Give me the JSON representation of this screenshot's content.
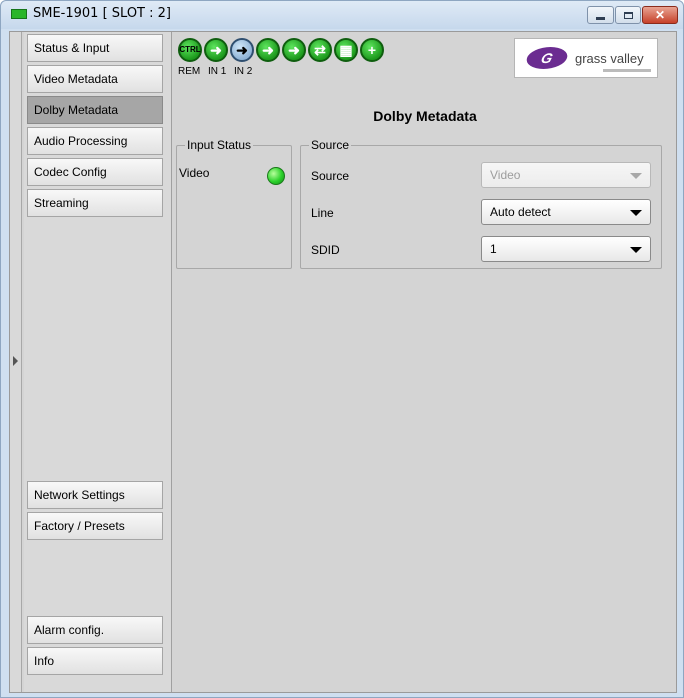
{
  "window": {
    "title": "SME-1901 [ SLOT : 2]",
    "controls": [
      "minimize",
      "maximize",
      "close"
    ]
  },
  "sidebar": {
    "items": [
      {
        "label": "Status & Input"
      },
      {
        "label": "Video Metadata"
      },
      {
        "label": "Dolby Metadata",
        "active": true
      },
      {
        "label": "Audio Processing"
      },
      {
        "label": "Codec Config"
      },
      {
        "label": "Streaming"
      },
      {
        "label": "Network Settings"
      },
      {
        "label": "Factory / Presets"
      },
      {
        "label": "Alarm config."
      },
      {
        "label": "Info"
      }
    ]
  },
  "toolbar": {
    "icons": [
      "ctrl-icon",
      "in1-arrow-icon",
      "in2-arrow-icon",
      "output-arrow-icon",
      "output-arrow-icon",
      "network-icon",
      "layout-icon",
      "add-icon"
    ],
    "ctrl_text": "CTRL",
    "labels": {
      "rem": "REM",
      "in1": "IN 1",
      "in2": "IN 2"
    }
  },
  "logo": {
    "text": "grass valley",
    "mark": "G",
    "color": "#6b2c91"
  },
  "panel": {
    "title": "Dolby Metadata",
    "input_status": {
      "legend": "Input Status",
      "video_label": "Video",
      "video_led_color": "#2bd12b"
    },
    "source": {
      "legend": "Source",
      "rows": [
        {
          "label": "Source",
          "value": "Video",
          "disabled": true
        },
        {
          "label": "Line",
          "value": "Auto detect",
          "disabled": false
        },
        {
          "label": "SDID",
          "value": "1",
          "disabled": false
        }
      ]
    }
  }
}
